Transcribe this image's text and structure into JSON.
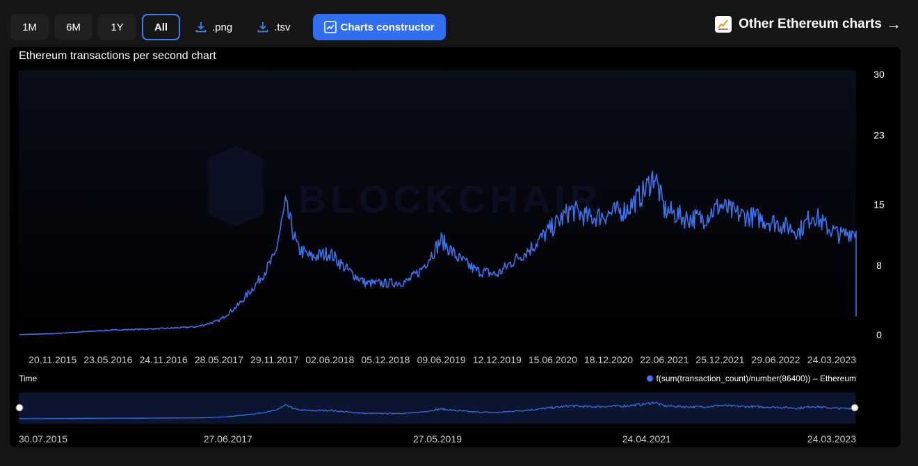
{
  "toolbar": {
    "ranges": [
      "1M",
      "6M",
      "1Y",
      "All"
    ],
    "active_range": "All",
    "png_label": ".png",
    "tsv_label": ".tsv",
    "constructor_label": "Charts constructor"
  },
  "other_link": {
    "label": "Other Ethereum charts"
  },
  "colors": {
    "accent": "#2f6ff0",
    "line": "#3b74f0",
    "background": "#000000"
  },
  "chart_data": {
    "type": "line",
    "title": "Ethereum transactions per second chart",
    "xlabel": "Time",
    "y_ticks": [
      "30",
      "23",
      "15",
      "8",
      "0"
    ],
    "ylim": [
      0,
      30
    ],
    "x_ticks": [
      "20.11.2015",
      "23.05.2016",
      "24.11.2016",
      "28.05.2017",
      "29.11.2017",
      "02.06.2018",
      "05.12.2018",
      "09.06.2019",
      "12.12.2019",
      "15.06.2020",
      "18.12.2020",
      "22.06.2021",
      "25.12.2021",
      "29.06.2022",
      "24.03.2023"
    ],
    "navigator_ticks": [
      "30.07.2015",
      "27.06.2017",
      "27.05.2019",
      "24.04.2021",
      "24.03.2023"
    ],
    "legend_position": "bottom-right",
    "grid": false,
    "series": [
      {
        "name": "f(sum(transaction_count)/number(86400)) – Ethereum",
        "x": [
          "2015-08-01",
          "2015-11-20",
          "2016-05-23",
          "2016-11-24",
          "2017-03-15",
          "2017-05-28",
          "2017-08-01",
          "2017-10-01",
          "2017-11-29",
          "2018-01-05",
          "2018-02-15",
          "2018-04-01",
          "2018-06-02",
          "2018-08-01",
          "2018-10-01",
          "2018-12-05",
          "2019-02-15",
          "2019-04-01",
          "2019-06-09",
          "2019-08-01",
          "2019-10-01",
          "2019-12-12",
          "2020-02-01",
          "2020-04-01",
          "2020-06-15",
          "2020-08-15",
          "2020-10-15",
          "2020-12-18",
          "2021-02-15",
          "2021-04-15",
          "2021-05-20",
          "2021-06-22",
          "2021-09-01",
          "2021-11-01",
          "2021-12-25",
          "2022-02-15",
          "2022-05-01",
          "2022-06-29",
          "2022-09-15",
          "2022-11-01",
          "2022-12-15",
          "2023-02-01",
          "2023-03-10",
          "2023-03-24"
        ],
        "values": [
          0.1,
          0.2,
          0.6,
          0.8,
          1.0,
          1.7,
          3.5,
          6.0,
          9.0,
          15.0,
          10.0,
          9.0,
          9.5,
          7.5,
          6.0,
          6.0,
          6.2,
          7.5,
          11.0,
          9.0,
          7.5,
          7.0,
          8.5,
          10.0,
          12.5,
          14.5,
          13.5,
          14.0,
          14.5,
          16.5,
          18.5,
          14.5,
          13.5,
          13.5,
          15.0,
          14.0,
          13.5,
          13.0,
          12.0,
          14.0,
          12.5,
          11.5,
          12.0,
          12.0
        ]
      }
    ]
  }
}
